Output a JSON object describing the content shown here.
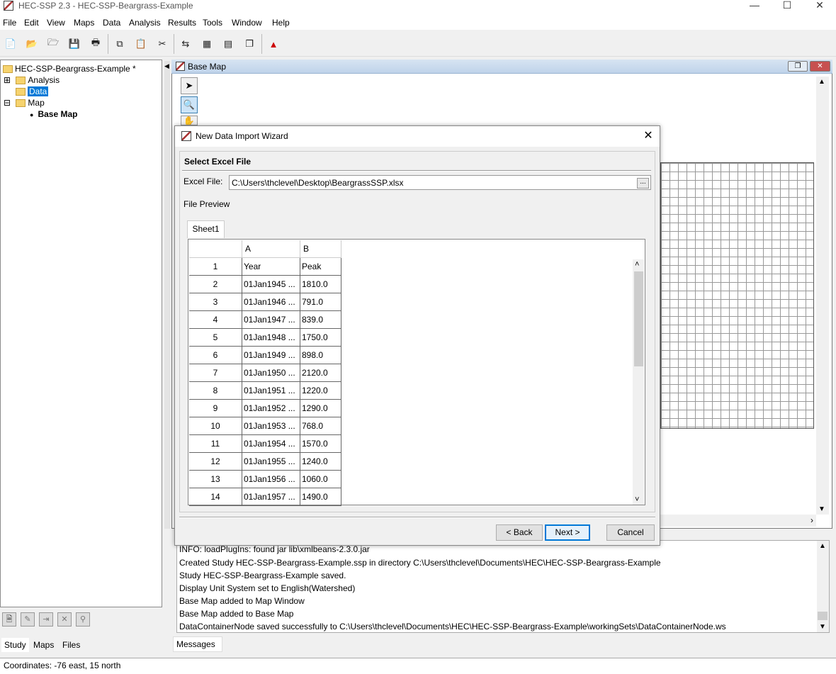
{
  "app": {
    "title": "HEC-SSP 2.3 - HEC-SSP-Beargrass-Example",
    "window_controls": {
      "minimize": "—",
      "maximize": "☐",
      "close": "✕"
    }
  },
  "menu": [
    "File",
    "Edit",
    "View",
    "Maps",
    "Data",
    "Analysis",
    "Results",
    "Tools",
    "Window",
    "Help"
  ],
  "toolbar": {
    "icons": [
      "new-study-icon",
      "open-study-icon",
      "open-example-icon",
      "save-icon",
      "print-icon",
      "copy-icon",
      "paste-icon",
      "cut-icon",
      "data-import-icon",
      "analysis-icon",
      "layout-icon",
      "cascade-icon",
      "chart-icon"
    ]
  },
  "tree": {
    "root": "HEC-SSP-Beargrass-Example *",
    "items": [
      {
        "label": "Analysis",
        "expander": "⊞"
      },
      {
        "label": "Data",
        "selected": true
      },
      {
        "label": "Map",
        "expander": "⊟"
      },
      {
        "label": "Base Map",
        "bold": true
      }
    ]
  },
  "left_tabs": [
    "Study",
    "Maps",
    "Files"
  ],
  "basemap": {
    "title": "Base Map"
  },
  "dialog": {
    "title": "New Data Import Wizard",
    "close": "✕",
    "section": "Select Excel File",
    "excel_label": "Excel File:",
    "excel_value": "C:\\Users\\thclevel\\Desktop\\BeargrassSSP.xlsx",
    "browse": "...",
    "preview_label": "File Preview",
    "sheet_tab": "Sheet1",
    "columns": [
      "A",
      "B"
    ],
    "rows": [
      {
        "n": "1",
        "a": "Year",
        "b": "Peak"
      },
      {
        "n": "2",
        "a": "01Jan1945 ...",
        "b": "1810.0"
      },
      {
        "n": "3",
        "a": "01Jan1946 ...",
        "b": "791.0"
      },
      {
        "n": "4",
        "a": "01Jan1947 ...",
        "b": "839.0"
      },
      {
        "n": "5",
        "a": "01Jan1948 ...",
        "b": "1750.0"
      },
      {
        "n": "6",
        "a": "01Jan1949 ...",
        "b": "898.0"
      },
      {
        "n": "7",
        "a": "01Jan1950 ...",
        "b": "2120.0"
      },
      {
        "n": "8",
        "a": "01Jan1951 ...",
        "b": "1220.0"
      },
      {
        "n": "9",
        "a": "01Jan1952 ...",
        "b": "1290.0"
      },
      {
        "n": "10",
        "a": "01Jan1953 ...",
        "b": "768.0"
      },
      {
        "n": "11",
        "a": "01Jan1954 ...",
        "b": "1570.0"
      },
      {
        "n": "12",
        "a": "01Jan1955 ...",
        "b": "1240.0"
      },
      {
        "n": "13",
        "a": "01Jan1956 ...",
        "b": "1060.0"
      },
      {
        "n": "14",
        "a": "01Jan1957 ...",
        "b": "1490.0"
      }
    ],
    "back": "< Back",
    "next": "Next >",
    "cancel": "Cancel"
  },
  "messages": {
    "lines": [
      "INFO: loadPlugIns: found jar lib\\xmlbeans-2.3.0.jar",
      "Created Study HEC-SSP-Beargrass-Example.ssp in directory C:\\Users\\thclevel\\Documents\\HEC\\HEC-SSP-Beargrass-Example",
      "Study HEC-SSP-Beargrass-Example saved.",
      "Display Unit System set to English(Watershed)",
      "Base Map added to Map Window",
      "Base Map added to Base Map",
      "DataContainerNode saved successfully to C:\\Users\\thclevel\\Documents\\HEC\\HEC-SSP-Beargrass-Example\\workingSets\\DataContainerNode.ws"
    ],
    "tab": "Messages"
  },
  "status": "Coordinates: -76 east, 15 north",
  "colors": {
    "selection": "#0078d7",
    "accent_border": "#0078d7"
  }
}
